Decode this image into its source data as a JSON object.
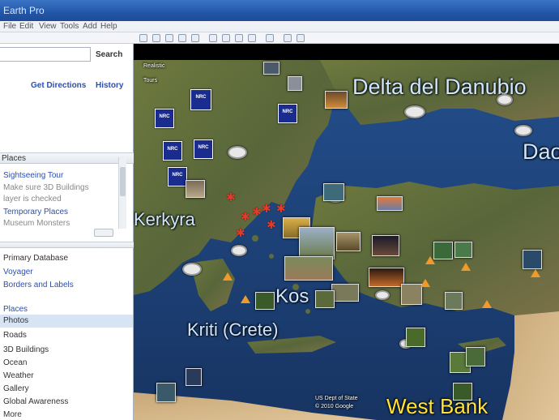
{
  "window": {
    "title": "Earth Pro"
  },
  "menu": {
    "items": [
      "File",
      "Edit",
      "View",
      "Tools",
      "Add",
      "Help"
    ]
  },
  "search": {
    "button_label": "Search",
    "get_directions": "Get Directions",
    "history": "History"
  },
  "places": {
    "header": "Places",
    "items": [
      {
        "label": "Sightseeing Tour",
        "link": true
      },
      {
        "label": "Make sure 3D Buildings",
        "link": false
      },
      {
        "label": "layer is checked",
        "link": false
      },
      {
        "label": "Temporary Places",
        "link": true
      },
      {
        "label": "Museum Monsters",
        "link": false
      }
    ]
  },
  "layers": {
    "items": [
      {
        "label": "Primary Database",
        "link": false
      },
      {
        "label": "Voyager",
        "link": true
      },
      {
        "label": "Borders and Labels",
        "link": true
      },
      {
        "label": "Places",
        "link": true
      },
      {
        "label": "Photos",
        "link": false
      },
      {
        "label": "Roads",
        "link": false
      },
      {
        "label": "3D Buildings",
        "link": false
      },
      {
        "label": "Ocean",
        "link": false
      },
      {
        "label": "Weather",
        "link": false
      },
      {
        "label": "Gallery",
        "link": false
      },
      {
        "label": "Global Awareness",
        "link": false
      },
      {
        "label": "More",
        "link": false
      }
    ]
  },
  "map": {
    "overlay_top": [
      "Realistic",
      "Tours"
    ],
    "labels": {
      "delta": "Delta del Danubio",
      "dao": "Dao",
      "kerkyra": "Kerkyra",
      "kos": "Kos",
      "kriti": "Kriti (Crete)",
      "west_bank": "West Bank"
    },
    "attribution": [
      "US Dept of State",
      "© 2010 Google"
    ],
    "marker_text": "NRC"
  },
  "colors": {
    "title_bar": "#2256a8",
    "link": "#2a4fb4",
    "sea": "#1d3f73",
    "land": "#5f6b3a",
    "place_label": "#ffffff",
    "highlight_label": "#ffe23a"
  }
}
